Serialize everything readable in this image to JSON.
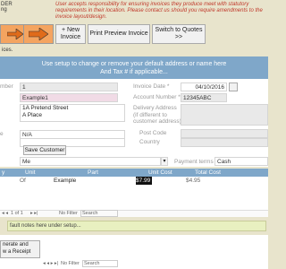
{
  "app": {
    "corner_top": "DER",
    "corner_sub": "ng"
  },
  "disclaimer": "User accepts responsibility for ensuring invoices they produce meet with statutory requirements in their location. Please contact us should you require amendments to the invoice layout/design.",
  "toolbar": {
    "new_invoice": "+ New Invoice",
    "print_preview": "Print Preview Invoice",
    "switch_quotes": "Switch to Quotes >>"
  },
  "section_label": "ices.",
  "banner": {
    "line1": "Use setup to change or remove your default address or name here",
    "line2": "And Tax # if applicable..."
  },
  "form": {
    "number_label": "mber",
    "number_value": "1",
    "invoice_date_label": "Invoice Date *",
    "invoice_date_value": "04/10/2016",
    "customer_value": "Example1",
    "account_label": "Account Number *",
    "account_value": "12345ABC",
    "address_line1": "1A Pretend Street",
    "address_line2": "A Place",
    "delivery_label_1": "Delivery Address",
    "delivery_label_2": "(if different to",
    "delivery_label_3": "customer address)",
    "phone_label": "e",
    "phone_value": "N/A",
    "postcode_label": "Post Code",
    "country_label": "Country",
    "save_customer": "Save Customer",
    "customer_select": "Me",
    "payment_terms_label": "Payment terms",
    "payment_terms_value": "Cash"
  },
  "grid": {
    "headers": [
      "y",
      "Unit",
      "Part",
      "Unit Cost",
      "Total Cost"
    ],
    "row": {
      "qty": "",
      "unit": "Of",
      "part": "Example",
      "unit_cost": "$7.99",
      "total_cost": "$4.95"
    }
  },
  "nav": {
    "record": "1 of 1",
    "filter": "No Filter",
    "search": "Search"
  },
  "notes": "fault notes here under setup...",
  "bottom": {
    "button_line1": "nerate and",
    "button_line2": "w a Receipt",
    "nav_text": "No Filter",
    "search": "Search"
  },
  "colors": {
    "accent": "#7fa7c9",
    "orange": "#f4a460",
    "background": "#e8e4cc"
  }
}
